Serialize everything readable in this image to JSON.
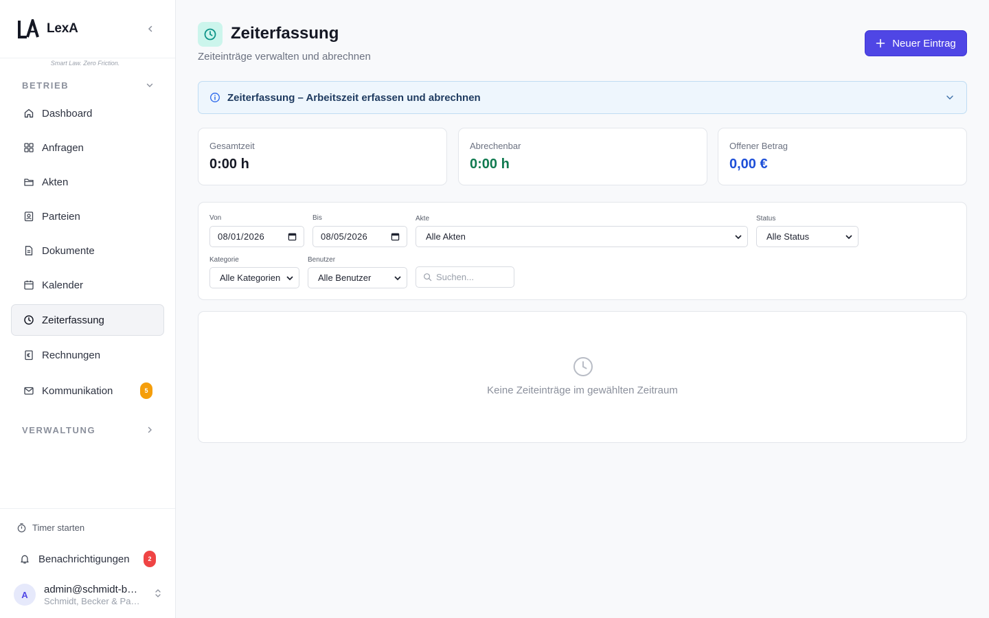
{
  "app": {
    "name": "LexA",
    "logo_text": "LA",
    "tagline": "Smart Law. Zero Friction."
  },
  "sidebar": {
    "sections": [
      {
        "title": "BETRIEB",
        "expanded": true,
        "items": [
          {
            "label": "Dashboard",
            "icon": "home-icon"
          },
          {
            "label": "Anfragen",
            "icon": "grid-icon"
          },
          {
            "label": "Akten",
            "icon": "folder-icon"
          },
          {
            "label": "Parteien",
            "icon": "contact-icon"
          },
          {
            "label": "Dokumente",
            "icon": "document-icon"
          },
          {
            "label": "Kalender",
            "icon": "calendar-icon"
          },
          {
            "label": "Zeiterfassung",
            "icon": "clock-icon",
            "active": true
          },
          {
            "label": "Rechnungen",
            "icon": "invoice-icon"
          },
          {
            "label": "Kommunikation",
            "icon": "mail-icon",
            "badge": "5"
          }
        ]
      },
      {
        "title": "VERWALTUNG",
        "expanded": false
      }
    ],
    "bottom": {
      "timer_label": "Timer starten",
      "notifications_label": "Benachrichtigungen",
      "notifications_badge": "2",
      "user": {
        "initial": "A",
        "email": "admin@schmidt-becker.de",
        "organization": "Schmidt, Becker & Partner"
      }
    }
  },
  "page": {
    "title": "Zeiterfassung",
    "subtitle": "Zeiteinträge verwalten und abrechnen",
    "new_button_label": "Neuer Eintrag"
  },
  "info_banner": {
    "text": "Zeiterfassung – Arbeitszeit erfassen und abrechnen"
  },
  "stats": [
    {
      "label": "Gesamtzeit",
      "value": "0:00 h",
      "color": "#151824"
    },
    {
      "label": "Abrechenbar",
      "value": "0:00 h",
      "color": "#0f7a4f"
    },
    {
      "label": "Offener Betrag",
      "value": "0,00 €",
      "color": "#1d4fd8"
    }
  ],
  "filters": {
    "von": {
      "label": "Von",
      "value": "08/01/2026"
    },
    "bis": {
      "label": "Bis",
      "value": "08/05/2026"
    },
    "akte": {
      "label": "Akte",
      "value": "Alle Akten"
    },
    "status": {
      "label": "Status",
      "value": "Alle Status"
    },
    "kategorie": {
      "label": "Kategorie",
      "value": "Alle Kategorien"
    },
    "benutzer": {
      "label": "Benutzer",
      "value": "Alle Benutzer"
    },
    "search": {
      "placeholder": "Suchen..."
    }
  },
  "empty_state": {
    "text": "Keine Zeiteinträge im gewählten Zeitraum"
  },
  "colors": {
    "accent": "#4f46e5",
    "page_icon_bg": "#ccf5ec",
    "page_icon_fg": "#0d9488",
    "info_bg": "#eef6fd",
    "badge_orange": "#f59e0b",
    "badge_red": "#ef4444"
  }
}
